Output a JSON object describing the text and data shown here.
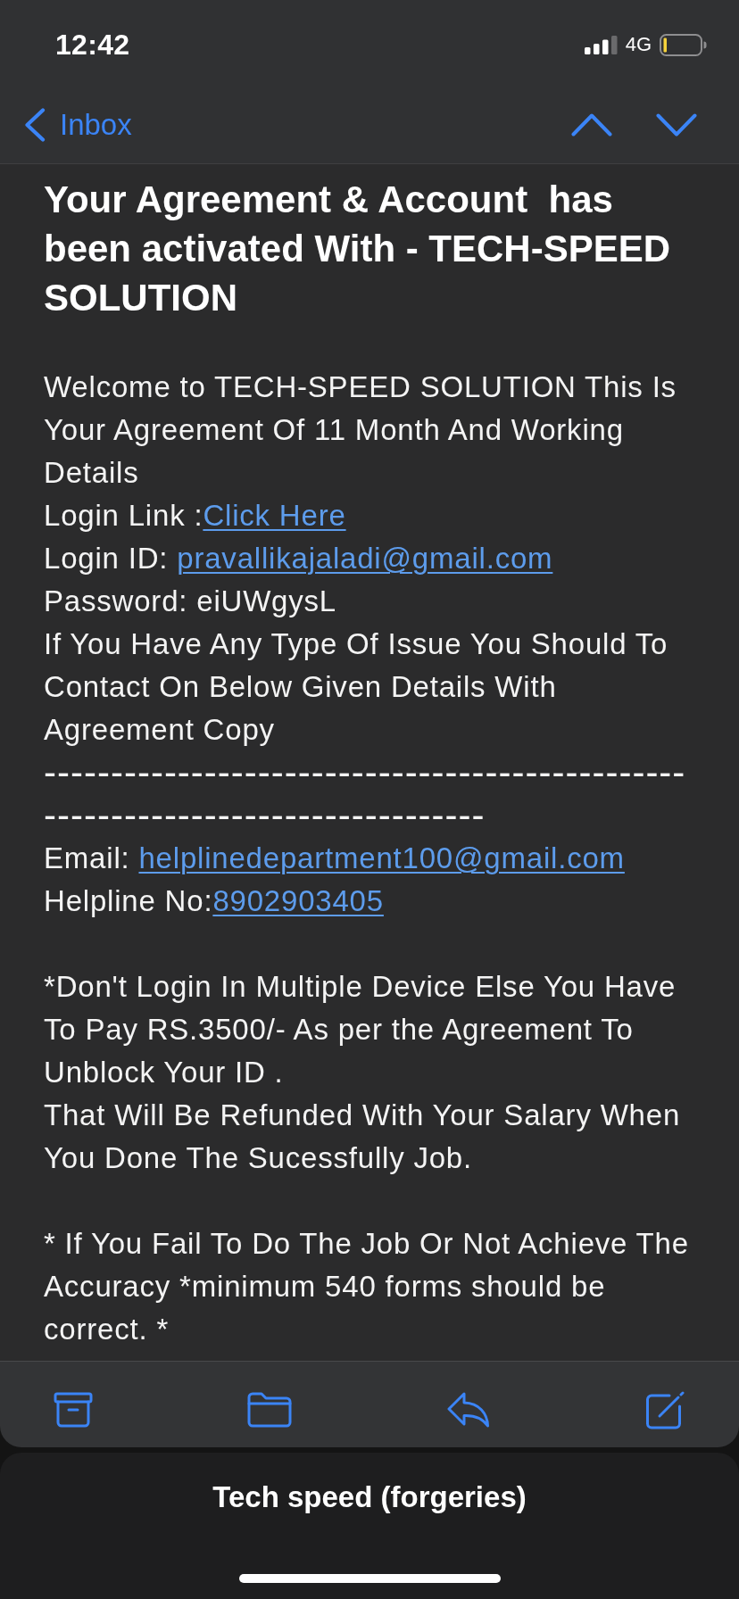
{
  "status_bar": {
    "time": "12:42",
    "network": "4G"
  },
  "nav_bar": {
    "back_label": "Inbox"
  },
  "message": {
    "subject": "Your Agreement & Account  has been activated With - TECH-SPEED SOLUTION",
    "sections": [
      [
        {
          "kind": "text",
          "text": "Welcome to TECH-SPEED SOLUTION This Is Your Agreement Of 11 Month And Working Details"
        },
        {
          "kind": "link",
          "label": "Login Link :",
          "link": "Click Here"
        },
        {
          "kind": "link",
          "label": "Login ID: ",
          "link": "pravallikajaladi@gmail.com"
        },
        {
          "kind": "text",
          "text": "Password: eiUWgysL"
        },
        {
          "kind": "text",
          "text": "If You Have Any Type Of Issue You Should To Contact On Below Given Details With Agreement Copy"
        },
        {
          "kind": "rule",
          "text": "---------------------------------------------------------------------------------"
        },
        {
          "kind": "link",
          "label": "Email: ",
          "link": "helplinedepartment100@gmail.com"
        },
        {
          "kind": "link",
          "label": "Helpline No:",
          "link": "8902903405"
        }
      ],
      [
        {
          "kind": "text",
          "text": "*Don't Login In Multiple Device Else You Have To Pay RS.3500/- As per the Agreement To Unblock Your ID ."
        },
        {
          "kind": "text",
          "text": "That Will Be Refunded With Your Salary When You Done The Sucessfully Job."
        }
      ],
      [
        {
          "kind": "text",
          "text": "* If You Fail To Do The Job Or Not Achieve The Accuracy *minimum 540 forms should be correct. *"
        }
      ]
    ]
  },
  "caption": "Tech speed (forgeries)"
}
